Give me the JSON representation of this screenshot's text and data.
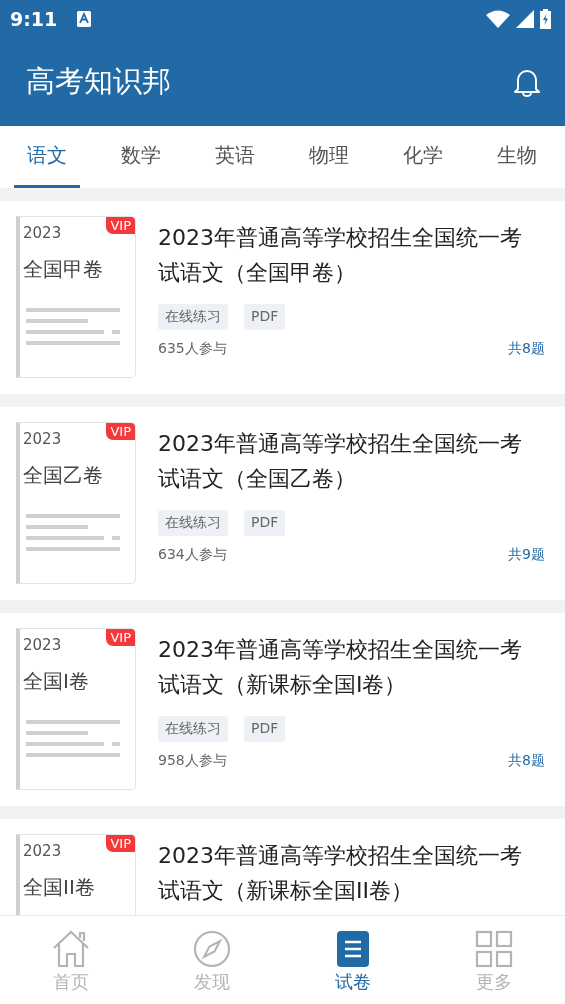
{
  "status_bar": {
    "time": "9:11"
  },
  "app_bar": {
    "title": "高考知识邦"
  },
  "tabs": [
    {
      "label": "语文",
      "selected": true
    },
    {
      "label": "数学",
      "selected": false
    },
    {
      "label": "英语",
      "selected": false
    },
    {
      "label": "物理",
      "selected": false
    },
    {
      "label": "化学",
      "selected": false
    },
    {
      "label": "生物",
      "selected": false
    }
  ],
  "papers": [
    {
      "year": "2023",
      "cover_name": "全国甲卷",
      "badge": "VIP",
      "title": "2023年普通高等学校招生全国统一考试语文（全国甲卷）",
      "tags": [
        "在线练习",
        "PDF"
      ],
      "participants": "635人参与",
      "question_count": "共8题"
    },
    {
      "year": "2023",
      "cover_name": "全国乙卷",
      "badge": "VIP",
      "title": "2023年普通高等学校招生全国统一考试语文（全国乙卷）",
      "tags": [
        "在线练习",
        "PDF"
      ],
      "participants": "634人参与",
      "question_count": "共9题"
    },
    {
      "year": "2023",
      "cover_name": "全国I卷",
      "badge": "VIP",
      "title": "2023年普通高等学校招生全国统一考试语文（新课标全国I卷）",
      "tags": [
        "在线练习",
        "PDF"
      ],
      "participants": "958人参与",
      "question_count": "共8题"
    },
    {
      "year": "2023",
      "cover_name": "全国II卷",
      "badge": "VIP",
      "title": "2023年普通高等学校招生全国统一考试语文（新课标全国II卷）"
    }
  ],
  "bottom_nav": [
    {
      "kind": "home",
      "label": "首页",
      "selected": false
    },
    {
      "kind": "discover",
      "label": "发现",
      "selected": false
    },
    {
      "kind": "papers",
      "label": "试卷",
      "selected": true
    },
    {
      "kind": "more",
      "label": "更多",
      "selected": false
    }
  ]
}
